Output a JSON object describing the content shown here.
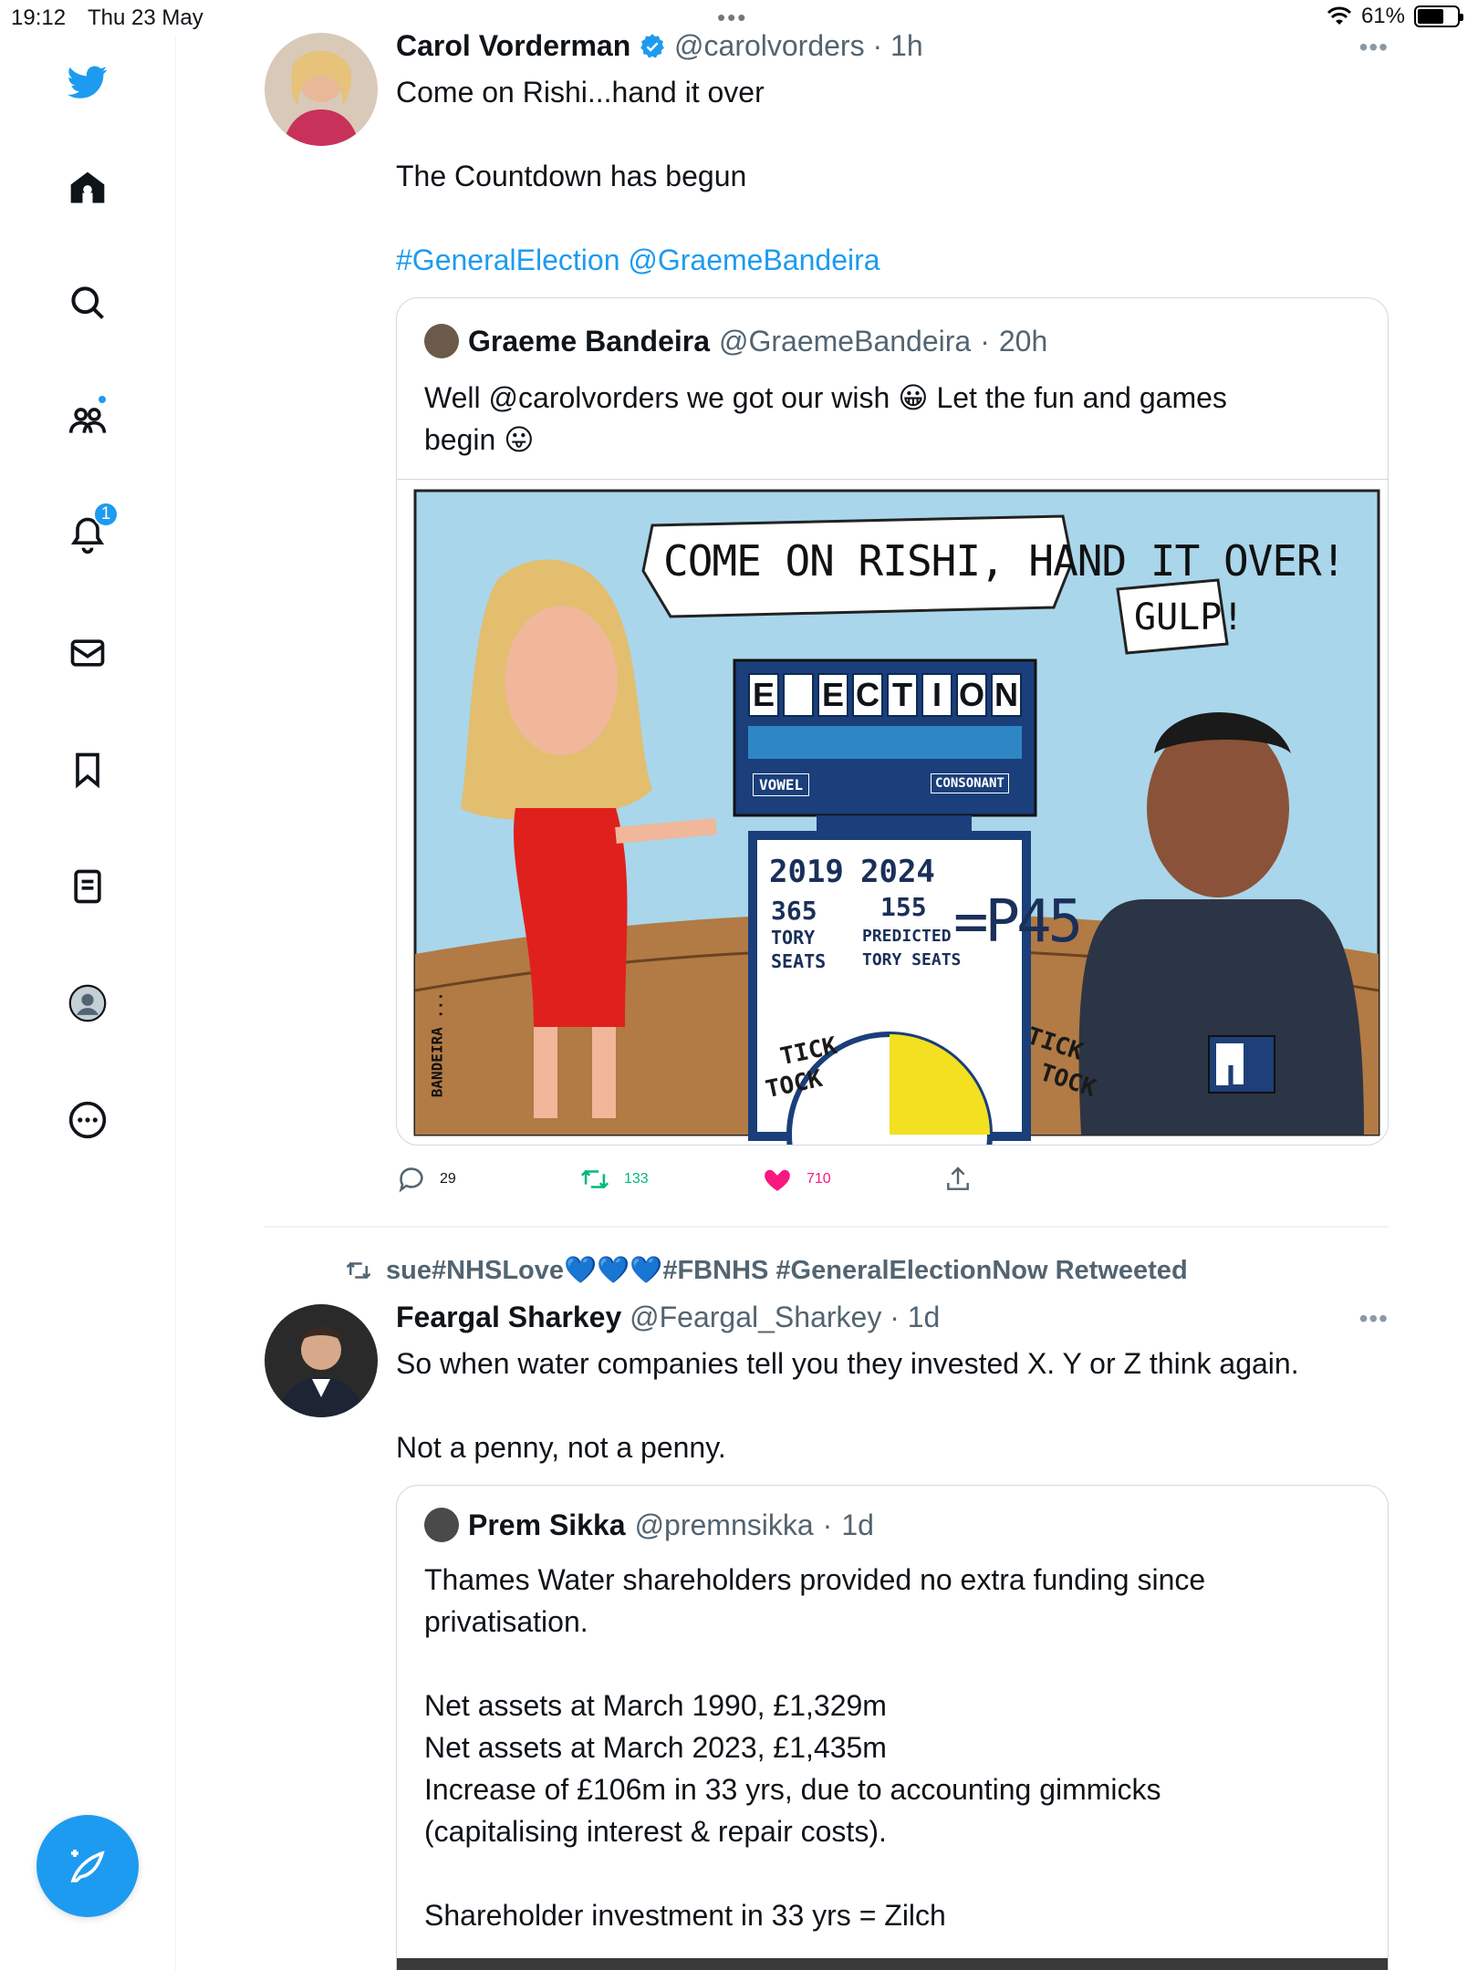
{
  "status_bar": {
    "time": "19:12",
    "date": "Thu 23 May",
    "battery": "61%"
  },
  "sidebar": {
    "notifications_count": "1",
    "items": [
      {
        "icon": "twitter-bird-icon"
      },
      {
        "icon": "home-icon"
      },
      {
        "icon": "search-icon"
      },
      {
        "icon": "communities-icon"
      },
      {
        "icon": "bell-icon"
      },
      {
        "icon": "mail-icon"
      },
      {
        "icon": "bookmark-icon"
      },
      {
        "icon": "lists-icon"
      },
      {
        "icon": "profile-icon"
      },
      {
        "icon": "more-icon"
      }
    ]
  },
  "tweet1": {
    "name": "Carol Vorderman",
    "handle": "@carolvorders",
    "time": "1h",
    "line1": "Come on Rishi...hand it over",
    "line2": "The Countdown has begun",
    "hashtag": "#GeneralElection",
    "mention": "@GraemeBandeira",
    "quote": {
      "name": "Graeme Bandeira",
      "handle": "@GraemeBandeira",
      "time": "20h",
      "text1": "Well @carolvorders we got our wish 😀 Let the fun and games",
      "text2": "begin 😛"
    },
    "cartoon": {
      "speech1": "COME ON RISHI, HAND IT OVER!",
      "speech2": "GULP!",
      "board_letters": [
        "E",
        "",
        "E",
        "C",
        "T",
        "I",
        "O",
        "N"
      ],
      "vowel": "VOWEL",
      "consonant": "CONSONANT",
      "year1": "2019",
      "year2": "2024",
      "seats1": "365",
      "seats1_label1": "TORY",
      "seats1_label2": "SEATS",
      "seats2": "155",
      "seats2_label1": "PREDICTED",
      "seats2_label2": "TORY SEATS",
      "result": "=P45",
      "tick1": "TICK",
      "tock1": "TOCK",
      "tick2": "TICK",
      "tock2": "TOCK",
      "signature": "BANDEIRA ...",
      "l_plate": "L"
    },
    "replies": "29",
    "retweets": "133",
    "likes": "710"
  },
  "tweet2": {
    "retweeted_by": "sue#NHSLove💙💙💙#FBNHS #GeneralElectionNow Retweeted",
    "name": "Feargal Sharkey",
    "handle": "@Feargal_Sharkey",
    "time": "1d",
    "line1": "So when water companies tell you they invested X. Y or Z think again.",
    "line2": "Not a penny, not a penny.",
    "quote": {
      "name": "Prem Sikka",
      "handle": "@premnsikka",
      "time": "1d",
      "l1": "Thames Water shareholders provided no extra funding since",
      "l2": "privatisation.",
      "l3": "Net assets at March 1990, £1,329m",
      "l4": "Net assets at March 2023, £1,435m",
      "l5": "Increase of £106m in 33 yrs, due to accounting gimmicks",
      "l6": "(capitalising interest & repair costs).",
      "l7": "Shareholder investment in 33 yrs = Zilch"
    }
  },
  "colors": {
    "brand": "#1d9bf0",
    "like": "#f91880",
    "retweet": "#00ba7c",
    "muted": "#536471"
  }
}
